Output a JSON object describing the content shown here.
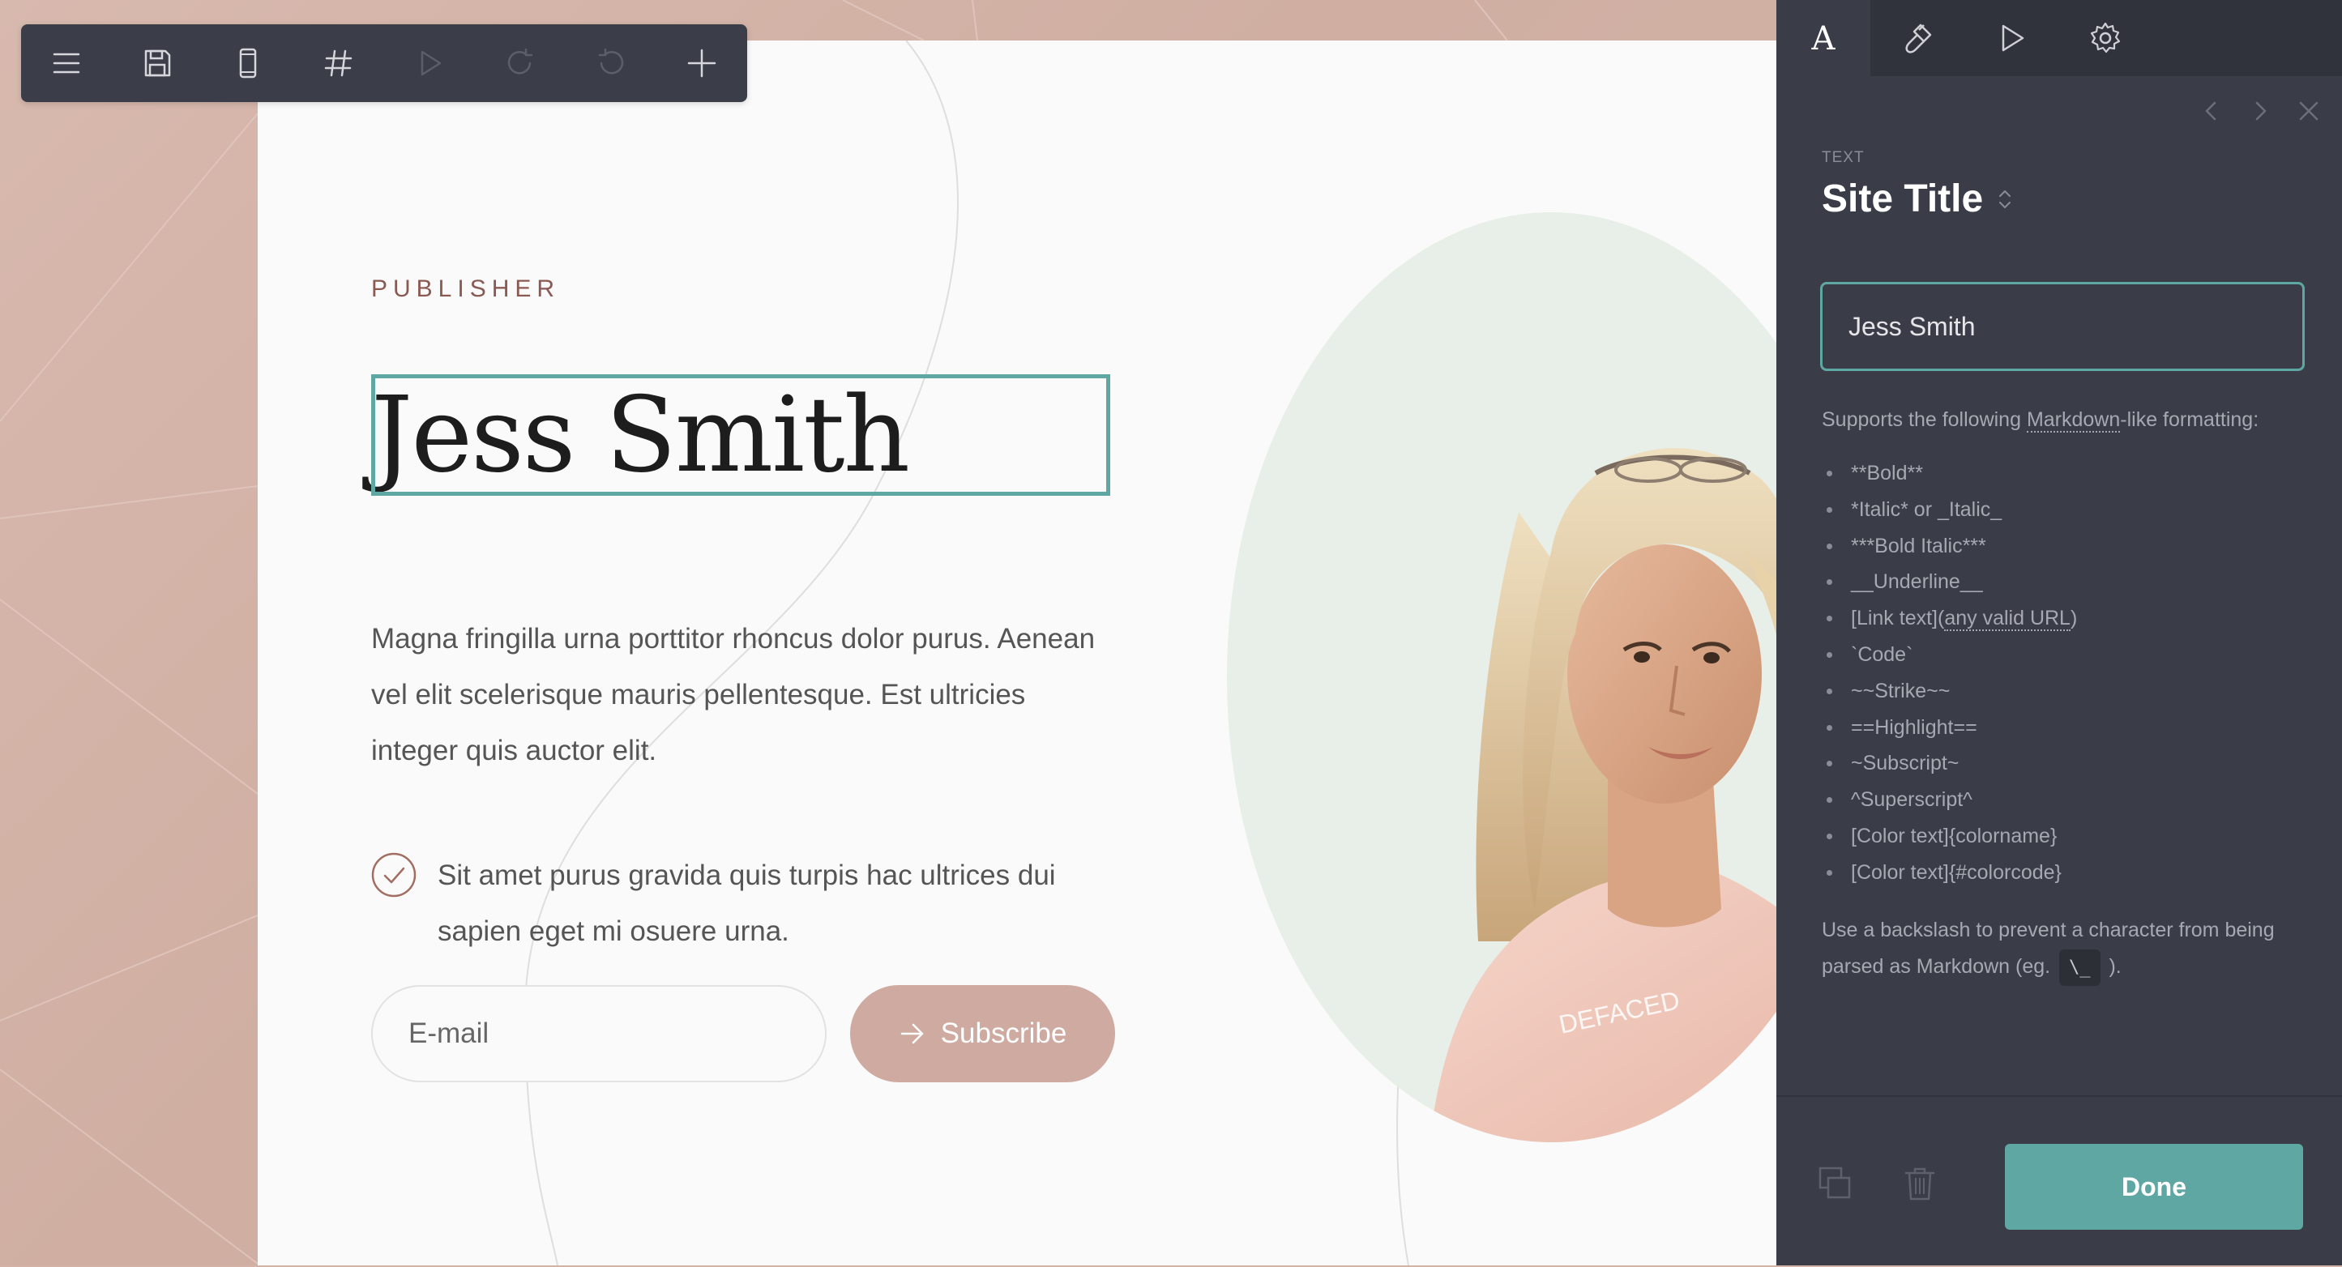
{
  "toolbar": {
    "buttons": [
      "menu-icon",
      "save-icon",
      "mobile-icon",
      "hash-icon",
      "play-icon",
      "redo-icon",
      "undo-icon",
      "plus-icon"
    ]
  },
  "hero": {
    "kicker": "PUBLISHER",
    "title": "Jess Smith",
    "paragraph": "Magna fringilla urna porttitor rhoncus dolor purus. Aenean vel elit scelerisque mauris pellentesque. Est ultricies integer quis auctor elit.",
    "check_text": "Sit amet purus gravida quis turpis hac ultrices dui sapien eget mi osuere urna.",
    "email_placeholder": "E-mail",
    "subscribe_label": "Subscribe",
    "shirt_print": "DEFACED"
  },
  "panel": {
    "tabs": [
      "text-icon",
      "brush-icon",
      "play-icon",
      "gear-icon"
    ],
    "section_label": "TEXT",
    "section_title": "Site Title",
    "field_value": "Jess Smith",
    "help_prefix": "Supports the following ",
    "help_link": "Markdown",
    "help_suffix": "-like formatting:",
    "format_list": [
      "**Bold**",
      "*Italic* or _Italic_",
      "***Bold Italic***",
      "__Underline__",
      "[Link text](",
      "`Code`",
      "~~Strike~~",
      "==Highlight==",
      "~Subscript~",
      "^Superscript^",
      "[Color text]{colorname}",
      "[Color text]{#colorcode}"
    ],
    "link_url_text": "any valid URL",
    "link_close": ")",
    "note_prefix": "Use a backslash to prevent a character from being parsed as Markdown (eg. ",
    "note_kbd": "\\_",
    "note_suffix": " ).",
    "done_label": "Done"
  },
  "colors": {
    "accent": "#5fa7a3",
    "button_pink": "#cfaaa0",
    "kicker": "#8a5a52",
    "panel_bg": "#3a3c47"
  }
}
